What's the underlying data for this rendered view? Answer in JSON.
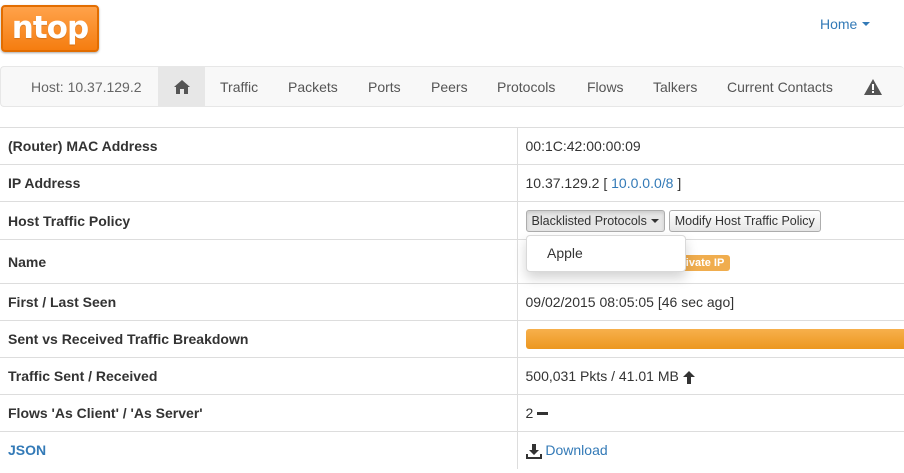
{
  "header": {
    "logo_text": "ntop",
    "home_menu_label": "Home"
  },
  "nav": {
    "host_label": "Host: 10.37.129.2",
    "home_icon": "home-icon",
    "tabs": [
      "Traffic",
      "Packets",
      "Ports",
      "Peers",
      "Protocols",
      "Flows",
      "Talkers",
      "Current Contacts"
    ],
    "alert_icon": "warning-icon"
  },
  "rows": {
    "mac": {
      "label": "(Router) MAC Address",
      "value": "00:1C:42:00:00:09"
    },
    "ip": {
      "label": "IP Address",
      "value": "10.37.129.2 [",
      "network_link": "10.0.0.0/8",
      "suffix": "]"
    },
    "policy": {
      "label": "Host Traffic Policy",
      "blacklist_button": "Blacklisted Protocols",
      "modify_button": "Modify Host Traffic Policy",
      "dropdown_items": [
        "Apple"
      ]
    },
    "name": {
      "label": "Name",
      "badge": "Private IP",
      "badge_visible_text": "rivate IP"
    },
    "seen": {
      "label": "First / Last Seen",
      "value": "09/02/2015 08:05:05 [46 sec ago]"
    },
    "breakdown": {
      "label": "Sent vs Received Traffic Breakdown",
      "sent_fraction": 1.0
    },
    "traffic": {
      "label": "Traffic Sent / Received",
      "value": "500,031 Pkts / 41.01 MB",
      "trend_icon": "arrow-up-icon"
    },
    "flows": {
      "label": "Flows 'As Client' / 'As Server'",
      "value": "2",
      "trend_icon": "minus-icon"
    },
    "json": {
      "label": "JSON",
      "download_label": "Download",
      "download_icon": "download-icon"
    }
  },
  "colors": {
    "brand_orange": "#f57d10",
    "link_blue": "#337ab7",
    "bar_orange": "#f0ad4e"
  }
}
